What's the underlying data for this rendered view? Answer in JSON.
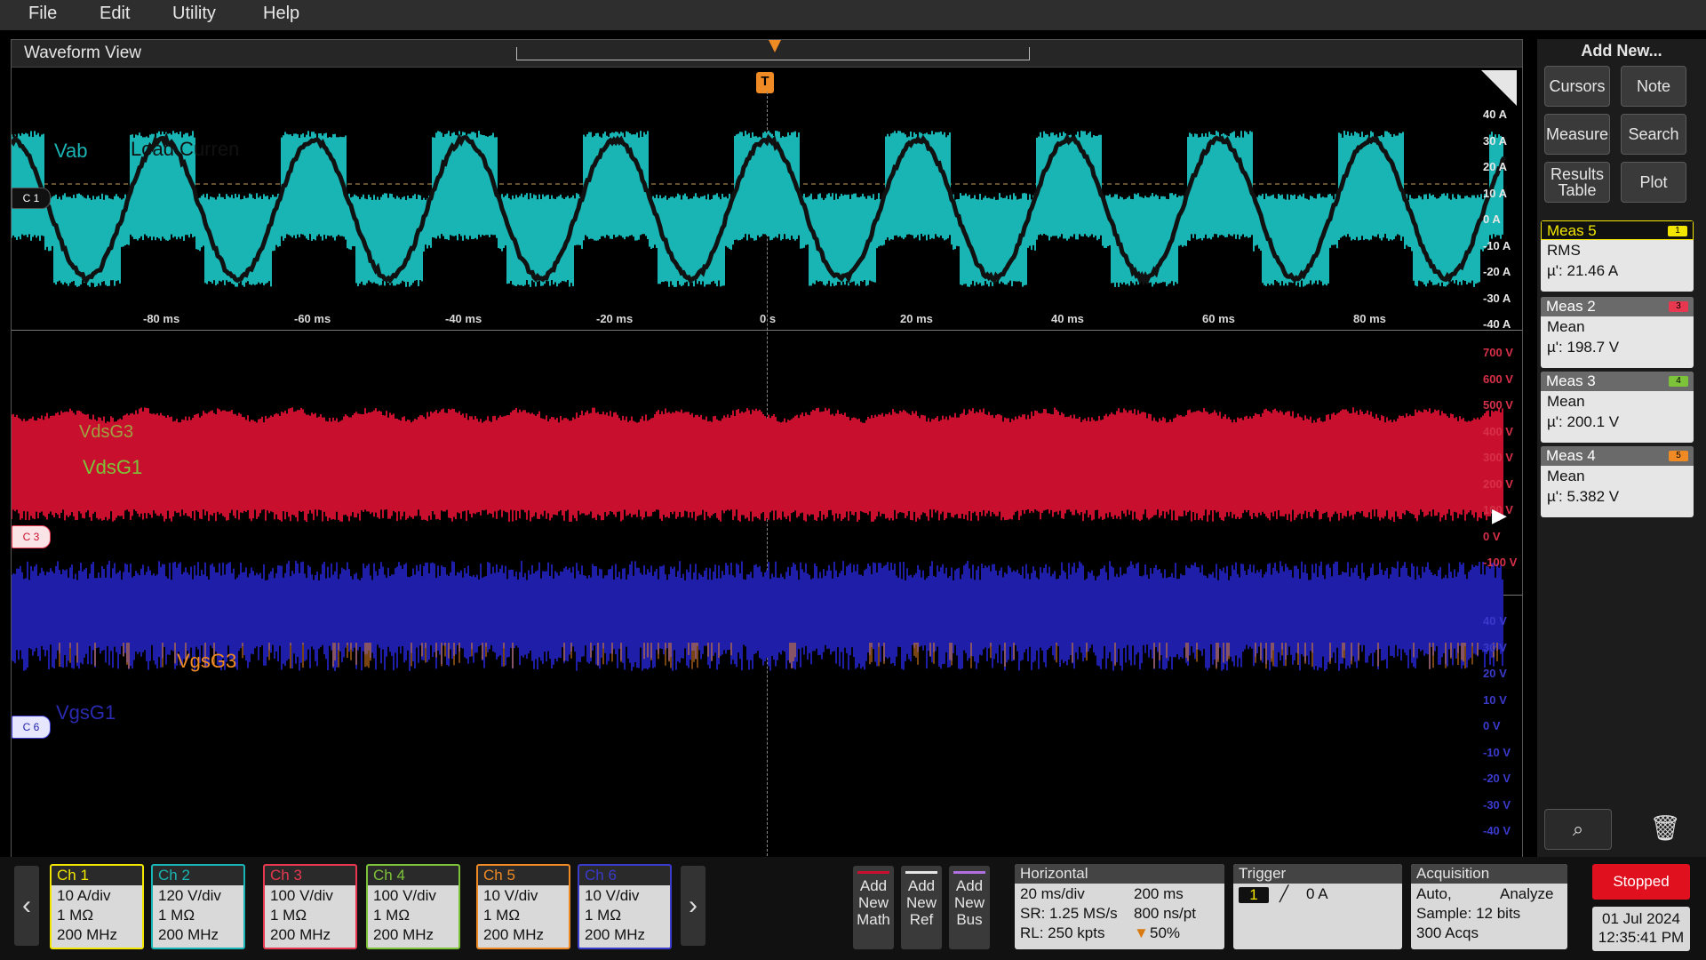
{
  "menu": [
    "File",
    "Edit",
    "Utility",
    "Help"
  ],
  "waveform_view": {
    "title": "Waveform View",
    "trigger_marker": "T",
    "pane1": {
      "labels": {
        "vab": "Vab",
        "load_current": "Load Curren"
      },
      "channel_tag": "C 1",
      "x_ticks": [
        "-80 ms",
        "-60 ms",
        "-40 ms",
        "-20 ms",
        "0 s",
        "20 ms",
        "40 ms",
        "60 ms",
        "80 ms"
      ],
      "y_ticks": [
        "40 A",
        "30 A",
        "20 A",
        "10 A",
        "0 A",
        "-10 A",
        "-20 A",
        "-30 A",
        "-40 A"
      ]
    },
    "pane2": {
      "labels": {
        "vdsg3": "VdsG3",
        "vdsg1": "VdsG1"
      },
      "channel_tag": "C 3",
      "y_ticks": [
        "700 V",
        "600 V",
        "500 V",
        "400 V",
        "300 V",
        "200 V",
        "100 V",
        "0 V",
        "-100 V"
      ]
    },
    "pane3": {
      "labels": {
        "vgsg3": "VgsG3",
        "vgsg1": "VgsG1"
      },
      "channel_tag": "C 6",
      "y_ticks": [
        "40 V",
        "30 V",
        "20 V",
        "10 V",
        "0 V",
        "-10 V",
        "-20 V",
        "-30 V",
        "-40 V"
      ]
    }
  },
  "right_panel": {
    "add_new": "Add New...",
    "buttons": {
      "cursors": "Cursors",
      "note": "Note",
      "measure": "Measure",
      "search": "Search",
      "results_table": "Results Table",
      "plot": "Plot"
    },
    "measurements": [
      {
        "name": "Meas 5",
        "type": "RMS",
        "value": "µ': 21.46 A",
        "badge": "1",
        "badge_color": "#f2e600"
      },
      {
        "name": "Meas 2",
        "type": "Mean",
        "value": "µ': 198.7 V",
        "badge": "3",
        "badge_color": "#e8384f"
      },
      {
        "name": "Meas 3",
        "type": "Mean",
        "value": "µ': 200.1 V",
        "badge": "4",
        "badge_color": "#7dc33a"
      },
      {
        "name": "Meas 4",
        "type": "Mean",
        "value": "µ': 5.382 V",
        "badge": "5",
        "badge_color": "#f08a24"
      }
    ]
  },
  "channels": [
    {
      "name": "Ch 1",
      "scale": "10 A/div",
      "impedance": "1 MΩ",
      "bandwidth": "200 MHz",
      "color": "#f2e600"
    },
    {
      "name": "Ch 2",
      "scale": "120 V/div",
      "impedance": "1 MΩ",
      "bandwidth": "200 MHz",
      "color": "#19b5b5"
    },
    {
      "name": "Ch 3",
      "scale": "100 V/div",
      "impedance": "1 MΩ",
      "bandwidth": "200 MHz",
      "color": "#e8384f"
    },
    {
      "name": "Ch 4",
      "scale": "100 V/div",
      "impedance": "1 MΩ",
      "bandwidth": "200 MHz",
      "color": "#7dc33a"
    },
    {
      "name": "Ch 5",
      "scale": "10 V/div",
      "impedance": "1 MΩ",
      "bandwidth": "200 MHz",
      "color": "#f08a24"
    },
    {
      "name": "Ch 6",
      "scale": "10 V/div",
      "impedance": "1 MΩ",
      "bandwidth": "200 MHz",
      "color": "#3a3acc"
    }
  ],
  "add_buttons": {
    "math": "Add New Math",
    "ref": "Add New Ref",
    "bus": "Add New Bus"
  },
  "horizontal": {
    "title": "Horizontal",
    "scale": "20 ms/div",
    "record_time": "200 ms",
    "sample_rate": "SR: 1.25 MS/s",
    "pt_time": "800 ns/pt",
    "record_length": "RL: 250 kpts",
    "position": "50%"
  },
  "trigger": {
    "title": "Trigger",
    "source": "1",
    "level": "0 A"
  },
  "acquisition": {
    "title": "Acquisition",
    "mode": "Auto,",
    "state": "Analyze",
    "sample": "Sample: 12 bits",
    "count": "300 Acqs"
  },
  "status": {
    "run_state": "Stopped",
    "date": "01 Jul 2024",
    "time": "12:35:41 PM"
  },
  "colors": {
    "teal": "#19b5b5",
    "black_trace": "#111111",
    "red_trace": "#c8102e",
    "blue_trace": "#1e1ea8",
    "orange_trace": "#f08a24"
  }
}
